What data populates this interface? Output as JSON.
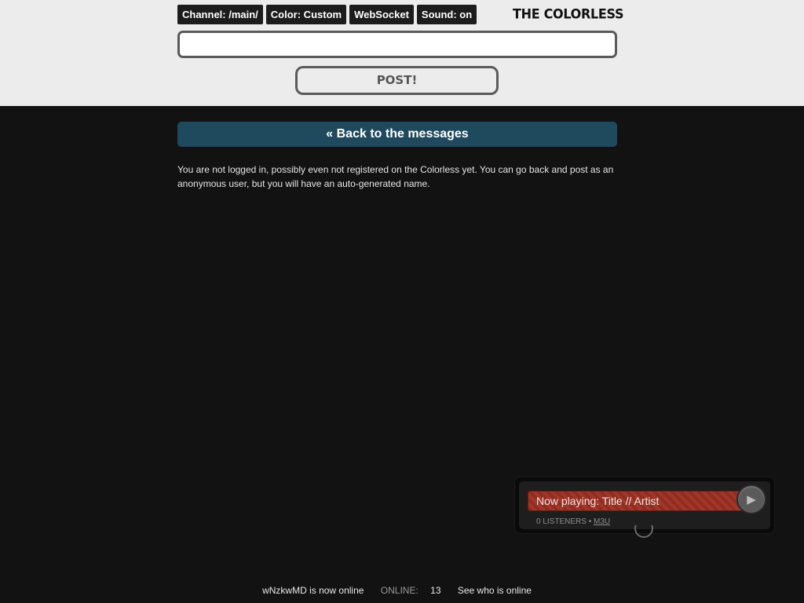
{
  "header": {
    "pills": {
      "channel": "Channel: /main/",
      "color": "Color: Custom",
      "socket": "WebSocket",
      "sound": "Sound: on"
    },
    "brand": "THE COLORLESS",
    "message_placeholder": "",
    "post_label": "POST!"
  },
  "main": {
    "back_label": "« Back to the messages",
    "notice": "You are not logged in, possibly even not registered on the Colorless yet. You can go back and post as an anonymous user, but you will have an auto-generated name."
  },
  "player": {
    "now_playing": "Now playing: Title // Artist",
    "play_icon": "play-icon",
    "listeners": "0 LISTENERS",
    "separator": "•",
    "m3u": "M3U",
    "accent": "#a33628"
  },
  "footer": {
    "status": "wNzkwMD is now online",
    "online_label": "ONLINE:",
    "online_count": "13",
    "who_link": "See who is online"
  }
}
